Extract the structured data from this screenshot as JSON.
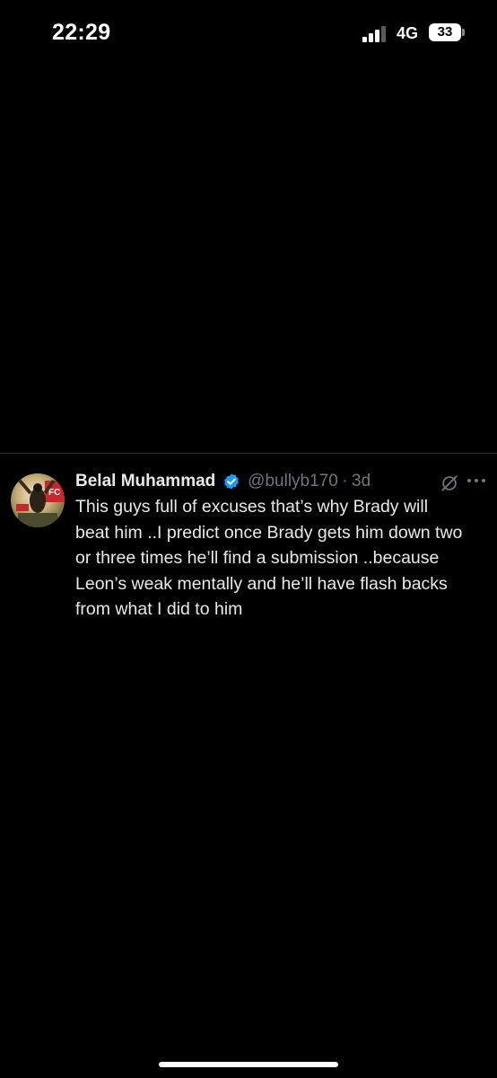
{
  "status_bar": {
    "time": "22:29",
    "network": "4G",
    "battery": "33",
    "icons": [
      "signal-bars-icon",
      "battery-icon"
    ]
  },
  "tweet": {
    "author_name": "Belal Muhammad",
    "handle": "@bullyb170",
    "separator": "·",
    "time_ago": "3d",
    "text": "This guys full of excuses that’s why Brady will\nbeat him ..I predict once Brady gets him down two\nor three times he’ll find a submission ..because\nLeon’s weak mentally and he’ll have flash backs\nfrom what I did to him",
    "icons": [
      "verified-badge-icon",
      "grok-icon",
      "more-options-icon"
    ]
  },
  "colors": {
    "background": "#000000",
    "text_primary": "#e7e9ea",
    "text_secondary": "#71767b",
    "verified_blue": "#1d9bf0"
  }
}
